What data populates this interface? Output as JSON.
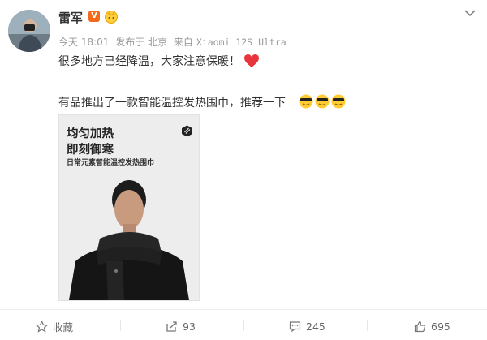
{
  "post": {
    "author": {
      "name": "雷军",
      "verified_badge": "V"
    },
    "meta": {
      "time": "今天 18:01",
      "location": "发布于 北京",
      "source_prefix": "来自",
      "source": "Xiaomi 12S Ultra"
    },
    "text": {
      "line1": "很多地方已经降温，大家注意保暖！",
      "line2": "有品推出了一款智能温控发热围巾，推荐一下"
    },
    "image": {
      "headline_1": "均匀加热",
      "headline_2": "即刻御寒",
      "subtitle": "日常元素智能温控发热围巾",
      "brand_icon": "hexagon-logo-icon"
    }
  },
  "actions": {
    "favorite": {
      "label": "收藏",
      "icon": "star-icon"
    },
    "repost": {
      "count": "93",
      "icon": "repost-icon"
    },
    "comment": {
      "count": "245",
      "icon": "comment-icon"
    },
    "like": {
      "count": "695",
      "icon": "thumbs-up-icon"
    }
  },
  "colors": {
    "accent": "#f46a1b",
    "heart": "#e8343b",
    "meta_text": "#999999",
    "body_text": "#333333"
  }
}
